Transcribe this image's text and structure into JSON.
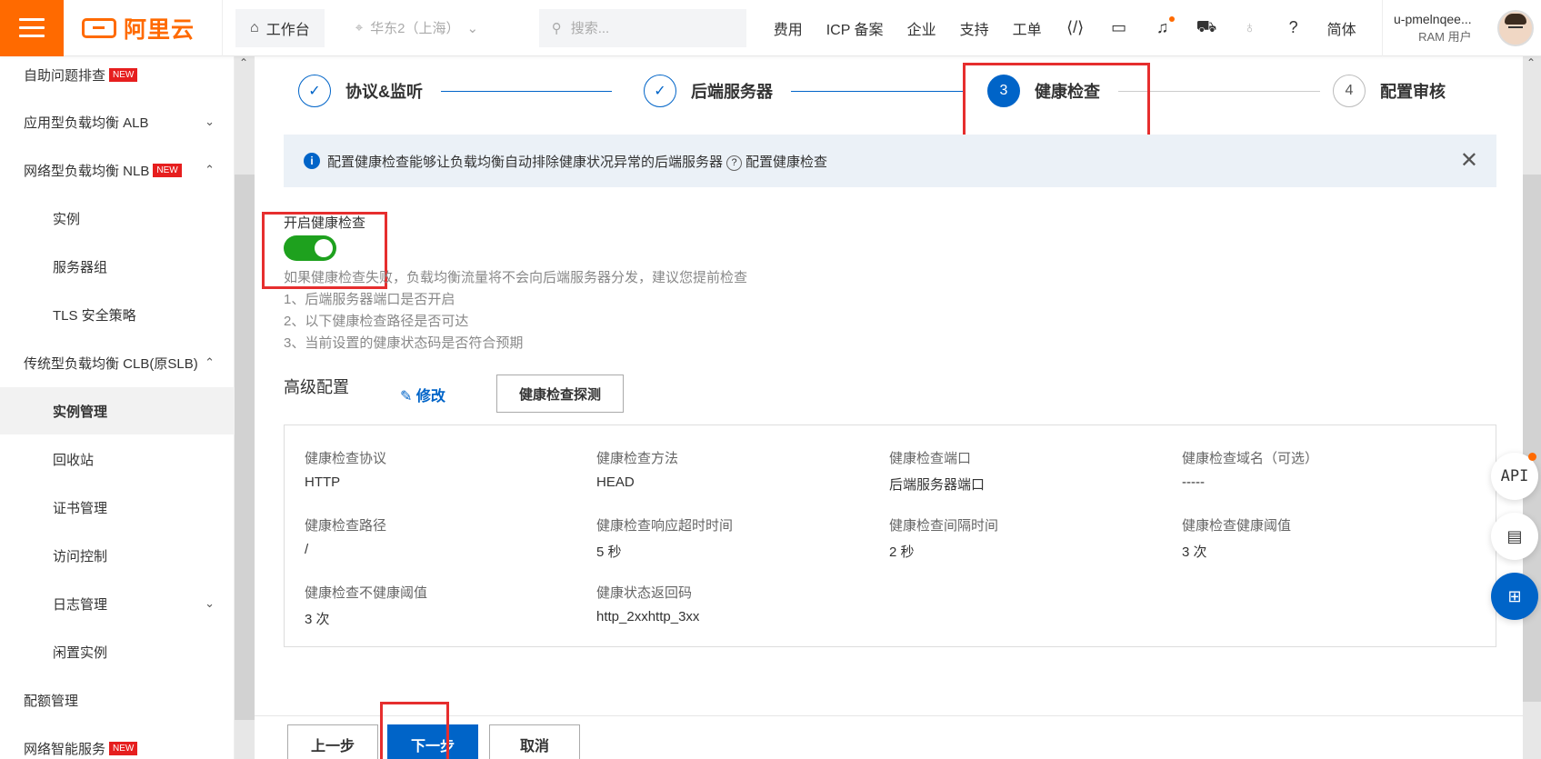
{
  "topbar": {
    "logo_text": "阿里云",
    "workbench": "工作台",
    "region": "华东2（上海）",
    "search_placeholder": "搜索...",
    "nav": [
      "费用",
      "ICP 备案",
      "企业",
      "支持",
      "工单"
    ],
    "lang": "简体",
    "username": "u-pmelnqee...",
    "user_role": "RAM 用户",
    "accent": "#ff6a00"
  },
  "sidebar": {
    "new_badge": "NEW",
    "items": [
      {
        "label": "自助问题排查"
      },
      {
        "label": "应用型负载均衡 ALB"
      },
      {
        "label": "网络型负载均衡 NLB"
      },
      {
        "label": "实例"
      },
      {
        "label": "服务器组"
      },
      {
        "label": "TLS 安全策略"
      },
      {
        "label": "传统型负载均衡 CLB(原SLB)"
      },
      {
        "label": "实例管理"
      },
      {
        "label": "回收站"
      },
      {
        "label": "证书管理"
      },
      {
        "label": "访问控制"
      },
      {
        "label": "日志管理"
      },
      {
        "label": "闲置实例"
      },
      {
        "label": "配额管理"
      },
      {
        "label": "网络智能服务"
      }
    ]
  },
  "steps": [
    {
      "num": "",
      "label": "协议&监听",
      "state": "done"
    },
    {
      "num": "",
      "label": "后端服务器",
      "state": "done"
    },
    {
      "num": "3",
      "label": "健康检查",
      "state": "current"
    },
    {
      "num": "4",
      "label": "配置审核",
      "state": "todo"
    }
  ],
  "info": {
    "text": "配置健康检查能够让负载均衡自动排除健康状况异常的后端服务器",
    "link": "配置健康检查"
  },
  "health": {
    "label": "开启健康检查",
    "enabled": true,
    "hint_lines": [
      "如果健康检查失败，负载均衡流量将不会向后端服务器分发，建议您提前检查",
      "1、后端服务器端口是否开启",
      "2、以下健康检查路径是否可达",
      "3、当前设置的健康状态码是否符合预期"
    ]
  },
  "advanced": {
    "title": "高级配置",
    "edit": "修改",
    "probe": "健康检查探测",
    "fields": [
      {
        "k": "健康检查协议",
        "v": "HTTP"
      },
      {
        "k": "健康检查方法",
        "v": "HEAD"
      },
      {
        "k": "健康检查端口",
        "v": "后端服务器端口"
      },
      {
        "k": "健康检查域名（可选）",
        "v": "-----"
      },
      {
        "k": "健康检查路径",
        "v": "/"
      },
      {
        "k": "健康检查响应超时时间",
        "v": "5 秒"
      },
      {
        "k": "健康检查间隔时间",
        "v": "2 秒"
      },
      {
        "k": "健康检查健康阈值",
        "v": "3 次"
      },
      {
        "k": "健康检查不健康阈值",
        "v": "3 次"
      },
      {
        "k": "健康状态返回码",
        "v": "http_2xxhttp_3xx"
      }
    ]
  },
  "footer": {
    "prev": "上一步",
    "next": "下一步",
    "cancel": "取消"
  },
  "floats": {
    "api": "API"
  }
}
